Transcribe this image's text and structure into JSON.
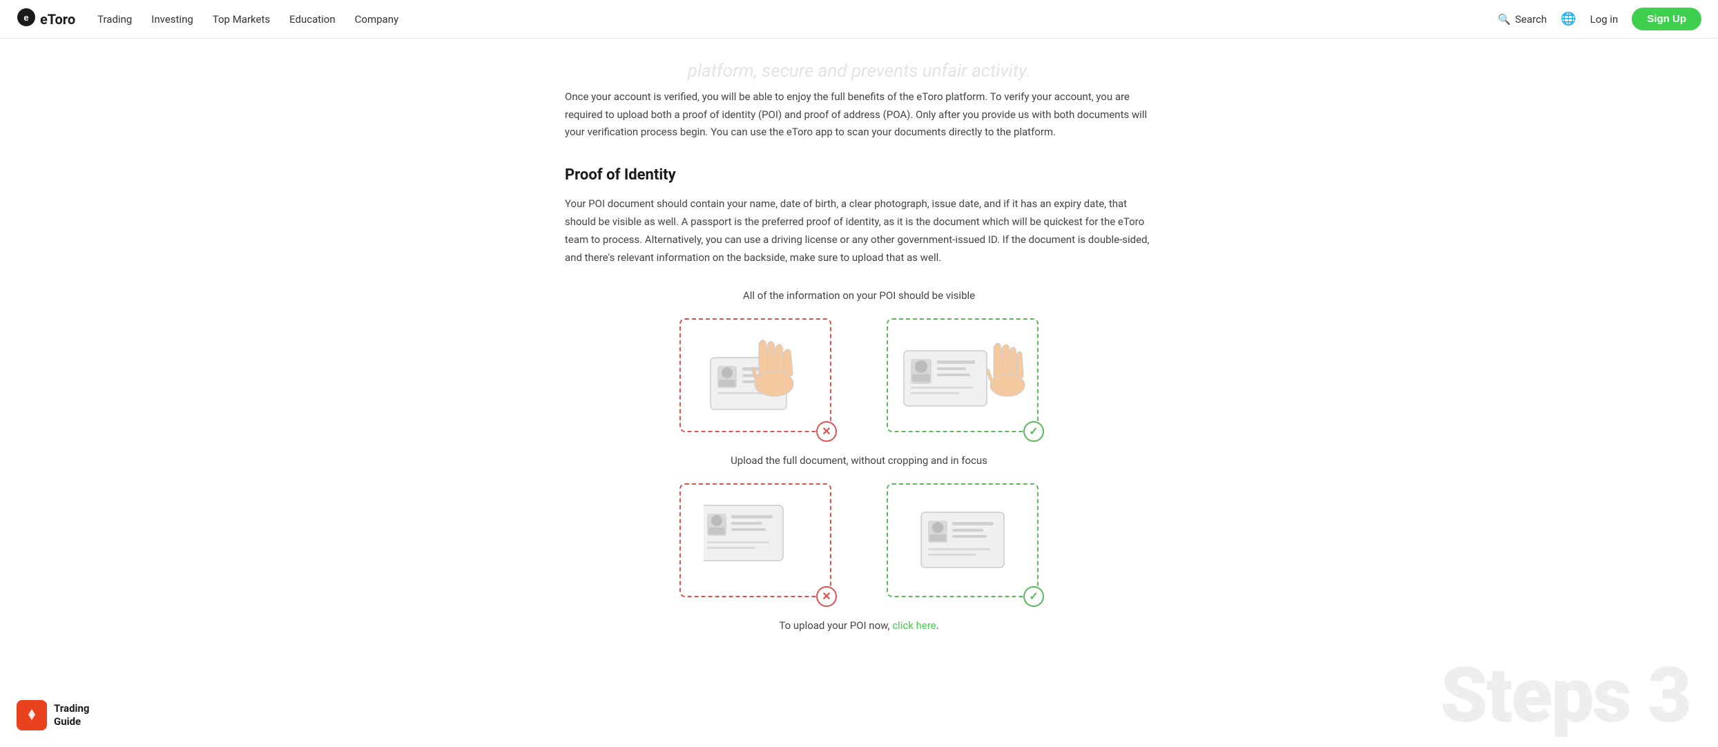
{
  "nav": {
    "logo_text": "etoro",
    "links": [
      {
        "label": "Trading",
        "id": "trading"
      },
      {
        "label": "Investing",
        "id": "investing"
      },
      {
        "label": "Top Markets",
        "id": "top-markets"
      },
      {
        "label": "Education",
        "id": "education"
      },
      {
        "label": "Company",
        "id": "company"
      }
    ],
    "search_label": "Search",
    "login_label": "Log in",
    "signup_label": "Sign Up"
  },
  "page": {
    "blurred_heading": "platform, secure and prevents unfair activity.",
    "intro_text": "Once your account is verified, you will be able to enjoy the full benefits of the eToro platform. To verify your account, you are required to upload both a proof of identity (POI) and proof of address (POA). Only after you provide us with both documents will your verification process begin. You can use the eToro app to scan your documents directly to the platform.",
    "section_title": "Proof of Identity",
    "body_text": "Your POI document should contain your name, date of birth, a clear photograph, issue date, and if it has an expiry date, that should be visible as well. A passport is the preferred proof of identity, as it is the document which will be quickest for the eToro team to process. Alternatively, you can use a driving license or any other government-issued ID. If the document is double-sided, and there's relevant information on the backside, make sure to upload that as well.",
    "caption1": "All of the information on your POI should be visible",
    "caption2": "Upload the full document, without cropping and in focus",
    "upload_text_before": "To upload your POI now,",
    "upload_link": "click here",
    "upload_text_after": ".",
    "watermark": "Steps 3",
    "badge": {
      "title": "Trading",
      "subtitle": "Guide"
    }
  }
}
